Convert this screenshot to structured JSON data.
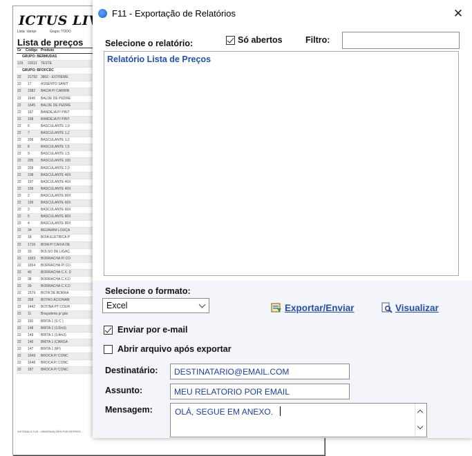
{
  "report": {
    "title": "ICTUS LIVE",
    "meta": [
      "Lista: Varejo",
      "Grupo: TODO"
    ],
    "heading": "Lista de preços",
    "columns": [
      "Gr",
      "Código",
      "Produto"
    ],
    "rows": [
      {
        "type": "group",
        "text": "GRUPO:  BERMUDAS"
      },
      {
        "gr": "129",
        "cod": "22021",
        "prod": "TESTE"
      },
      {
        "type": "group",
        "text": "GRUPO:  BFOFCDC"
      },
      {
        "gr": "22",
        "cod": "21792",
        "prod": "3802 - EXTREME"
      },
      {
        "gr": "22",
        "cod": "17",
        "prod": "ASSENTO SANIT"
      },
      {
        "gr": "22",
        "cod": "1582",
        "prod": "BACIA P/ CARRIN"
      },
      {
        "gr": "22",
        "cod": "1646",
        "prod": "BALDE DE PEDRE"
      },
      {
        "gr": "22",
        "cod": "1645",
        "prod": "BALDE DE PEDRE"
      },
      {
        "gr": "22",
        "cod": "167",
        "prod": "BANDEJA P/ PINT"
      },
      {
        "gr": "22",
        "cod": "168",
        "prod": "BANDEJA P/ PINT"
      },
      {
        "gr": "22",
        "cod": "6",
        "prod": "BASCULANTE 1,0"
      },
      {
        "gr": "22",
        "cod": "7",
        "prod": "BASCULANTE 1,2"
      },
      {
        "gr": "22",
        "cod": "206",
        "prod": "BASCULANTE 1,2"
      },
      {
        "gr": "22",
        "cod": "8",
        "prod": "BASCULANTE 1,5"
      },
      {
        "gr": "22",
        "cod": "9",
        "prod": "BASCULANTE 1,5"
      },
      {
        "gr": "22",
        "cod": "205",
        "prod": "BASCULANTE 100"
      },
      {
        "gr": "22",
        "cod": "209",
        "prod": "BASCULANTE 2,0"
      },
      {
        "gr": "22",
        "cod": "108",
        "prod": "BASCULANTE 40X"
      },
      {
        "gr": "22",
        "cod": "197",
        "prod": "BASCULANTE 40X"
      },
      {
        "gr": "22",
        "cod": "109",
        "prod": "BASCULANTE 40X"
      },
      {
        "gr": "22",
        "cod": "2",
        "prod": "BASCULANTE 60X"
      },
      {
        "gr": "22",
        "cod": "199",
        "prod": "BASCULANTE 60X"
      },
      {
        "gr": "22",
        "cod": "3",
        "prod": "BASCULANTE 60X"
      },
      {
        "gr": "22",
        "cod": "5",
        "prod": "BASCULANTE 80X"
      },
      {
        "gr": "22",
        "cod": "4",
        "prod": "BASCULANTE 80X"
      },
      {
        "gr": "22",
        "cod": "34",
        "prod": "BEIJAMIM LOUÇA"
      },
      {
        "gr": "22",
        "cod": "18",
        "prod": "BOIA ELETRICA P"
      },
      {
        "gr": "22",
        "cod": "1716",
        "prod": "BOIA P/ CAIXA DE"
      },
      {
        "gr": "22",
        "cod": "33",
        "prod": "BOLSO DE LIGAÇ"
      },
      {
        "gr": "22",
        "cod": "1653",
        "prod": "BORRACHA P/ CO"
      },
      {
        "gr": "22",
        "cod": "1654",
        "prod": "BORRACHA P/ CO"
      },
      {
        "gr": "22",
        "cod": "40",
        "prod": "BORRACHA C.X. D"
      },
      {
        "gr": "22",
        "cod": "38",
        "prod": "BORRACHA C.X.D"
      },
      {
        "gr": "22",
        "cod": "39",
        "prod": "BORRACHA C.X.D"
      },
      {
        "gr": "22",
        "cod": "1579",
        "prod": "BOTA DE BORRA"
      },
      {
        "gr": "22",
        "cod": "358",
        "prod": "BOTAO ACIONAM"
      },
      {
        "gr": "22",
        "cod": "1442",
        "prod": "BOTINA PT COUR"
      },
      {
        "gr": "22",
        "cod": "11",
        "prod": "Braçadeira p/ gás"
      },
      {
        "gr": "22",
        "cod": "150",
        "prod": "BRITA 1  (S C )"
      },
      {
        "gr": "22",
        "cod": "148",
        "prod": "BRITA 1  (1/2m3)"
      },
      {
        "gr": "22",
        "cod": "149",
        "prod": "BRITA 1  (1/4m3)"
      },
      {
        "gr": "22",
        "cod": "146",
        "prod": "BRITA 1 (CARGA"
      },
      {
        "gr": "22",
        "cod": "147",
        "prod": "BRITA 1 (M³)"
      },
      {
        "gr": "22",
        "cod": "1649",
        "prod": "BROCA P/ CONC"
      },
      {
        "gr": "22",
        "cod": "1648",
        "prod": "BROCA P/ CONC"
      },
      {
        "gr": "22",
        "cod": "187",
        "prod": "BROCA P/ CONC"
      }
    ],
    "footer": "SISTEMA ICTUS - OBSERVAÇÕES POR REPRES."
  },
  "dialog": {
    "title": "F11 - Exportação de Relatórios",
    "select_report_label": "Selecione o relatório:",
    "only_open_label": "Só abertos",
    "only_open_checked": true,
    "filter_label": "Filtro:",
    "filter_value": "",
    "reports": [
      "Relatório Lista de Preços"
    ],
    "format_label": "Selecione o formato:",
    "format_value": "Excel",
    "export_link": "Exportar/Enviar",
    "view_link": "Visualizar",
    "send_email_label": "Enviar por e-mail",
    "send_email_checked": true,
    "open_after_label": "Abrir arquivo após exportar",
    "open_after_checked": false,
    "recipient_label": "Destinatário:",
    "recipient_value": "DESTINATARIO@EMAIL.COM",
    "subject_label": "Assunto:",
    "subject_value": "MEU RELATORIO POR EMAIL",
    "message_label": "Mensagem:",
    "message_value": "OLÁ, SEGUE EM ANEXO.",
    "close_glyph": "✕"
  },
  "icons": [
    "app-icon",
    "close-icon",
    "export-icon",
    "view-icon",
    "chevron-down-icon",
    "scroll-up-icon",
    "scroll-down-icon"
  ],
  "colors": {
    "link": "#1f4fb0",
    "input_text": "#1a3fa6",
    "bottom_panel": "#f3f5fa"
  }
}
